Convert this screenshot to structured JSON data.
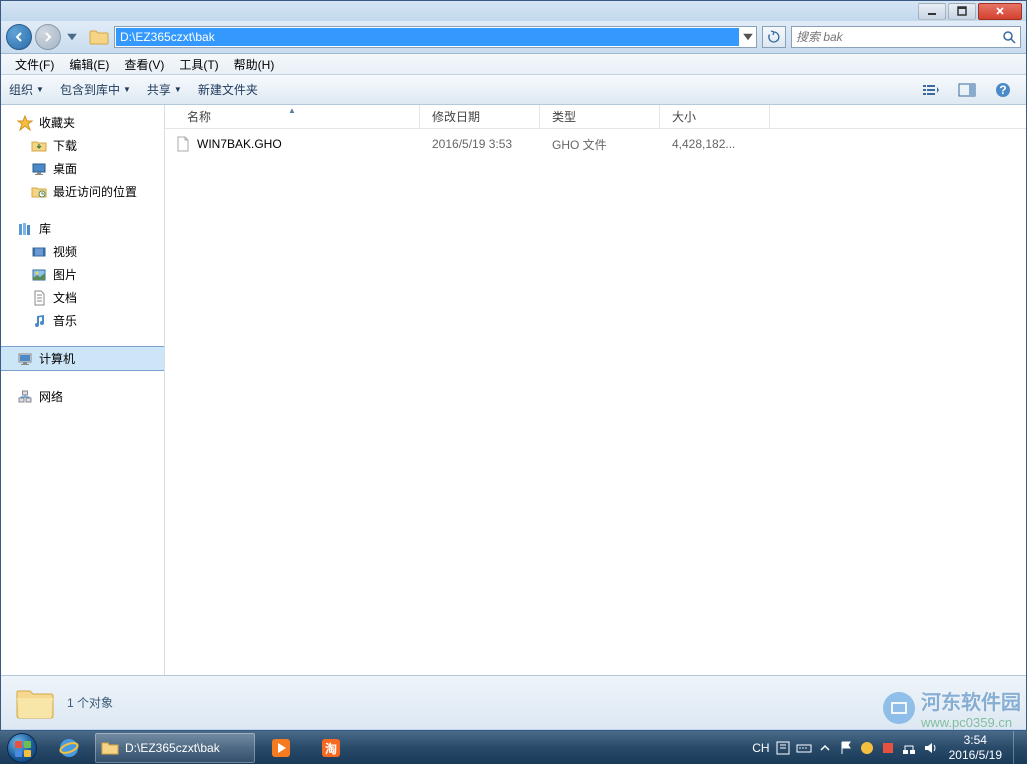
{
  "window": {
    "address_path": "D:\\EZ365czxt\\bak",
    "search_placeholder": "搜索 bak"
  },
  "menus": {
    "file": "文件(F)",
    "edit": "编辑(E)",
    "view": "查看(V)",
    "tools": "工具(T)",
    "help": "帮助(H)"
  },
  "toolbar": {
    "organize": "组织",
    "include": "包含到库中",
    "share": "共享",
    "new_folder": "新建文件夹"
  },
  "sidebar": {
    "favorites": {
      "label": "收藏夹",
      "items": [
        "下载",
        "桌面",
        "最近访问的位置"
      ]
    },
    "libraries": {
      "label": "库",
      "items": [
        "视频",
        "图片",
        "文档",
        "音乐"
      ]
    },
    "computer": {
      "label": "计算机"
    },
    "network": {
      "label": "网络"
    }
  },
  "columns": {
    "name": "名称",
    "date": "修改日期",
    "type": "类型",
    "size": "大小"
  },
  "files": [
    {
      "name": "WIN7BAK.GHO",
      "date": "2016/5/19 3:53",
      "type": "GHO 文件",
      "size": "4,428,182..."
    }
  ],
  "statusbar": {
    "text": "1 个对象"
  },
  "taskbar": {
    "active_title": "D:\\EZ365czxt\\bak",
    "ime": "CH",
    "time": "3:54",
    "date": "2016/5/19"
  },
  "watermark": {
    "text": "河东软件园",
    "url": "www.pc0359.cn"
  }
}
